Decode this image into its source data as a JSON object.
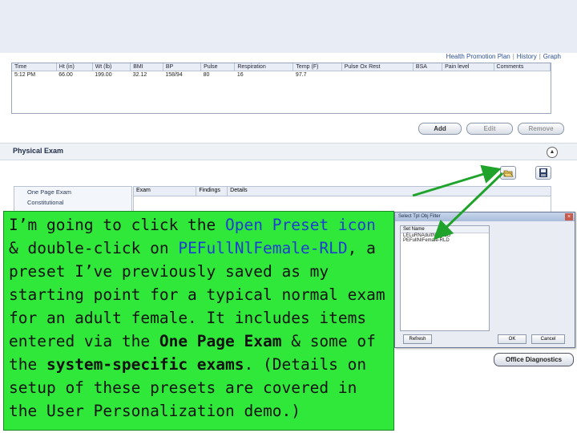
{
  "links": {
    "health_promotion": "Health Promotion Plan",
    "history": "History",
    "graph": "Graph"
  },
  "vitals": {
    "headers": [
      "Time",
      "Ht (in)",
      "Wt (lb)",
      "BMI",
      "BP",
      "Pulse",
      "Respiration",
      "Temp (F)",
      "Pulse Ox Rest",
      "BSA",
      "Pain level",
      "Comments"
    ],
    "row": [
      "5:12 PM",
      "66.00",
      "199.00",
      "32.12",
      "158/94",
      "80",
      "16",
      "97.7",
      "",
      "",
      "",
      ""
    ]
  },
  "buttons": {
    "add": "Add",
    "edit": "Edit",
    "remove": "Remove",
    "office_diagnostics": "Office Diagnostics"
  },
  "physical_exam": {
    "title": "Physical Exam",
    "tree": [
      "One Page Exam",
      "Constitutional"
    ],
    "grid_headers": [
      "Exam",
      "Findings",
      "Details"
    ]
  },
  "dialog": {
    "title": "Select Tpl Obj Filter",
    "list_header": "Set Name",
    "items": [
      "LELuRNAdultNIFiRLD",
      "PEFullNIFemale-RLD"
    ],
    "refresh": "Refresh",
    "ok": "OK",
    "cancel": "Cancel"
  },
  "callout": {
    "t1": "I’m going to click the ",
    "t2": "Open Preset icon",
    "t3": " & double-click on ",
    "t4": "PEFullNlFemale-RLD",
    "t5": ", a preset I’ve previously saved as my starting point for a typical normal exam for an adult female.  It includes items entered via the ",
    "t6": "One Page Exam",
    "t7": " & some of the ",
    "t8": "system-specific exams",
    "t9": ".  (Details on setup of these presets are covered in the User Personalization demo.)"
  },
  "colors": {
    "callout_bg": "#2fe83a",
    "highlight_text": "#1d3fd0",
    "arrow": "#1fa32a"
  }
}
